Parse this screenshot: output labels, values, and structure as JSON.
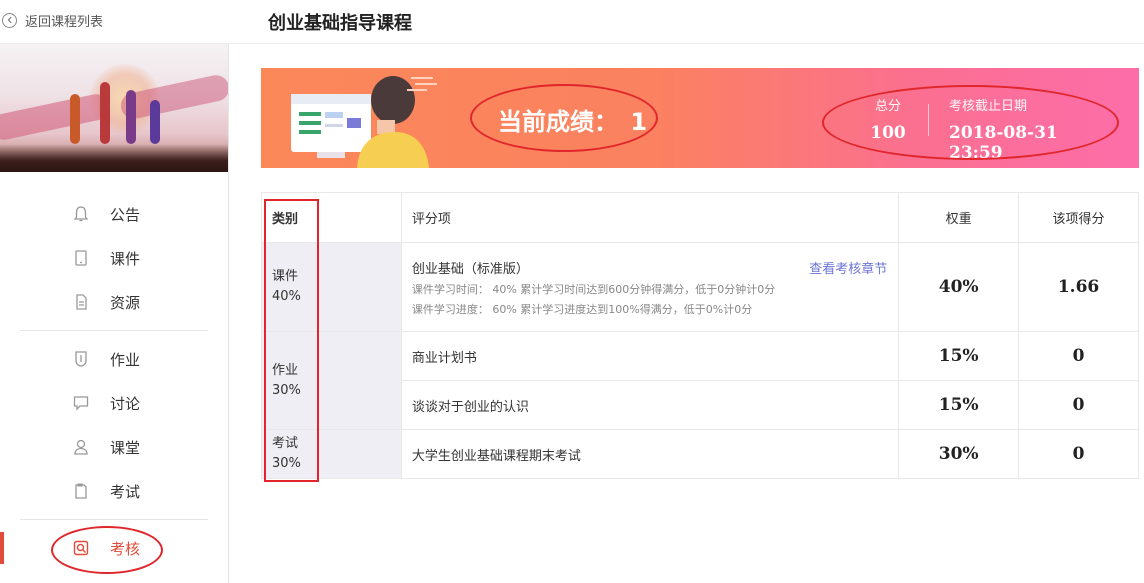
{
  "header": {
    "back_label": "返回课程列表",
    "title": "创业基础指导课程"
  },
  "sidebar": {
    "items": [
      {
        "label": "公告",
        "icon": "bell-icon"
      },
      {
        "label": "课件",
        "icon": "tablet-icon"
      },
      {
        "label": "资源",
        "icon": "resource-icon"
      },
      {
        "label": "作业",
        "icon": "pencil-shield-icon"
      },
      {
        "label": "讨论",
        "icon": "chat-icon"
      },
      {
        "label": "课堂",
        "icon": "person-icon"
      },
      {
        "label": "考试",
        "icon": "exam-icon"
      },
      {
        "label": "考核",
        "icon": "assessment-icon",
        "active": true
      }
    ]
  },
  "summary": {
    "current_score_label": "当前成绩：",
    "current_score": "1",
    "total_label": "总分",
    "total_value": "100",
    "deadline_label": "考核截止日期",
    "deadline_value": "2018-08-31 23:59"
  },
  "table": {
    "headers": [
      "类别",
      "评分项",
      "权重",
      "该项得分"
    ],
    "categories": [
      {
        "name": "课件",
        "weight": "40%"
      },
      {
        "name": "作业",
        "weight": "30%"
      },
      {
        "name": "考试",
        "weight": "30%"
      }
    ],
    "rows": [
      {
        "item": "创业基础（标准版）",
        "link": "查看考核章节",
        "detail1": "课件学习时间： 40%   累计学习时间达到600分钟得满分，低于0分钟计0分",
        "detail2": "课件学习进度： 60%   累计学习进度达到100%得满分，低于0%计0分",
        "weight": "40%",
        "score": "1.66"
      },
      {
        "item": "商业计划书",
        "weight": "15%",
        "score": "0"
      },
      {
        "item": "谈谈对于创业的认识",
        "weight": "15%",
        "score": "0"
      },
      {
        "item": "大学生创业基础课程期末考试",
        "weight": "30%",
        "score": "0"
      }
    ]
  },
  "colors": {
    "accent": "#e04b3a",
    "annotation_red": "#e0262b",
    "link": "#6c74d6",
    "category_bg": "#eeeef4"
  }
}
